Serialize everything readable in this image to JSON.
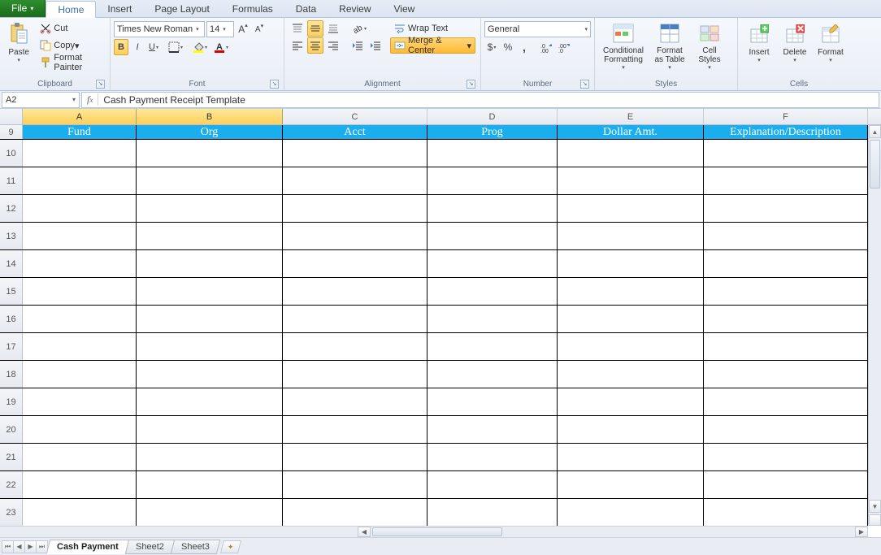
{
  "tabs": {
    "file": "File",
    "home": "Home",
    "insert": "Insert",
    "pageLayout": "Page Layout",
    "formulas": "Formulas",
    "data": "Data",
    "review": "Review",
    "view": "View"
  },
  "ribbon": {
    "clipboard": {
      "label": "Clipboard",
      "paste": "Paste",
      "cut": "Cut",
      "copy": "Copy",
      "formatPainter": "Format Painter"
    },
    "font": {
      "label": "Font",
      "name": "Times New Roman",
      "size": "14"
    },
    "alignment": {
      "label": "Alignment",
      "wrap": "Wrap Text",
      "merge": "Merge & Center"
    },
    "number": {
      "label": "Number",
      "format": "General"
    },
    "styles": {
      "label": "Styles",
      "conditional": "Conditional\nFormatting",
      "formatTable": "Format\nas Table",
      "cellStyles": "Cell\nStyles"
    },
    "cells": {
      "label": "Cells",
      "insert": "Insert",
      "delete": "Delete",
      "format": "Format"
    }
  },
  "nameBox": "A2",
  "formula": "Cash Payment Receipt Template",
  "columns": [
    "A",
    "B",
    "C",
    "D",
    "E",
    "F"
  ],
  "headerRow": {
    "num": "9",
    "cells": [
      "Fund",
      "Org",
      "Acct",
      "Prog",
      "Dollar Amt.",
      "Explanation/Description"
    ]
  },
  "dataRows": [
    "10",
    "11",
    "12",
    "13",
    "14",
    "15",
    "16",
    "17",
    "18",
    "19",
    "20",
    "21",
    "22",
    "23"
  ],
  "sheetTabs": {
    "s1": "Cash Payment",
    "s2": "Sheet2",
    "s3": "Sheet3"
  }
}
